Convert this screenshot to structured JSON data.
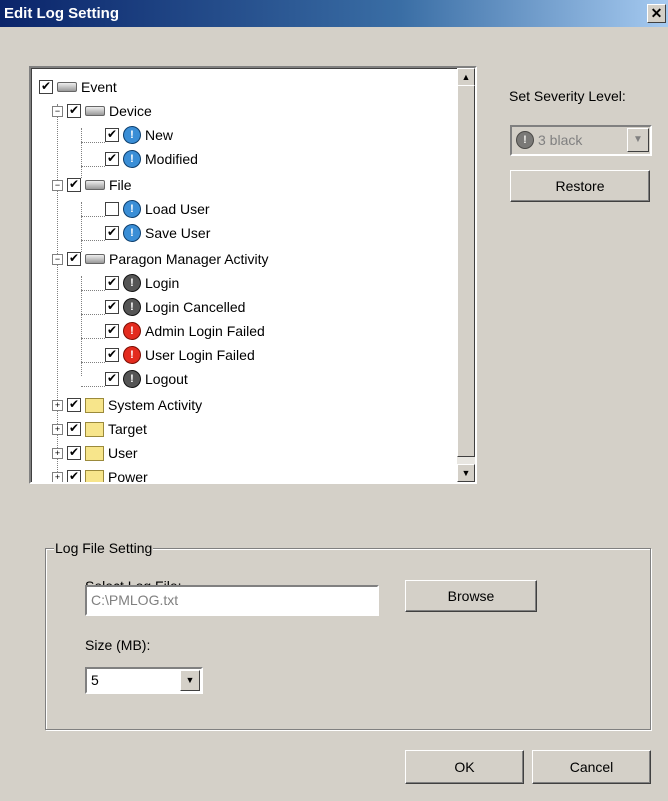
{
  "window": {
    "title": "Edit Log Setting",
    "close": "✕"
  },
  "tree": {
    "nodes": [
      {
        "label": "Event",
        "checked": true,
        "icon": "device-icon"
      },
      {
        "label": "Device",
        "checked": true,
        "icon": "device-icon"
      },
      {
        "label": "New",
        "checked": true,
        "icon": "severity-blue-icon"
      },
      {
        "label": "Modified",
        "checked": true,
        "icon": "severity-blue-icon"
      },
      {
        "label": "File",
        "checked": true,
        "icon": "device-icon"
      },
      {
        "label": "Load User",
        "checked": false,
        "icon": "severity-blue-icon"
      },
      {
        "label": "Save User",
        "checked": true,
        "icon": "severity-blue-icon"
      },
      {
        "label": "Paragon Manager Activity",
        "checked": true,
        "icon": "device-icon"
      },
      {
        "label": "Login",
        "checked": true,
        "icon": "severity-black-icon"
      },
      {
        "label": "Login Cancelled",
        "checked": true,
        "icon": "severity-black-icon"
      },
      {
        "label": "Admin Login Failed",
        "checked": true,
        "icon": "severity-red-icon"
      },
      {
        "label": "User Login Failed",
        "checked": true,
        "icon": "severity-red-icon"
      },
      {
        "label": "Logout",
        "checked": true,
        "icon": "severity-black-icon"
      },
      {
        "label": "System Activity",
        "checked": true,
        "icon": "folder-icon"
      },
      {
        "label": "Target",
        "checked": true,
        "icon": "folder-icon"
      },
      {
        "label": "User",
        "checked": true,
        "icon": "folder-icon"
      },
      {
        "label": "Power",
        "checked": true,
        "icon": "folder-icon"
      }
    ],
    "check_glyph": "✔",
    "expanded_glyph": "−",
    "collapsed_glyph": "+"
  },
  "severity": {
    "label": "Set Severity Level:",
    "value": "3 black",
    "restore": "Restore"
  },
  "log_file": {
    "group_title": "Log File Setting",
    "select_label": "Select Log File:",
    "path_value": "C:\\PMLOG.txt",
    "browse": "Browse",
    "size_label": "Size (MB):",
    "size_value": "5"
  },
  "footer": {
    "ok": "OK",
    "cancel": "Cancel"
  },
  "colors": {
    "title_bar": "#0a246a",
    "face": "#d4d0c8",
    "severity_blue": "#3a8ed6",
    "severity_red": "#e32b1e",
    "severity_black": "#555555"
  }
}
